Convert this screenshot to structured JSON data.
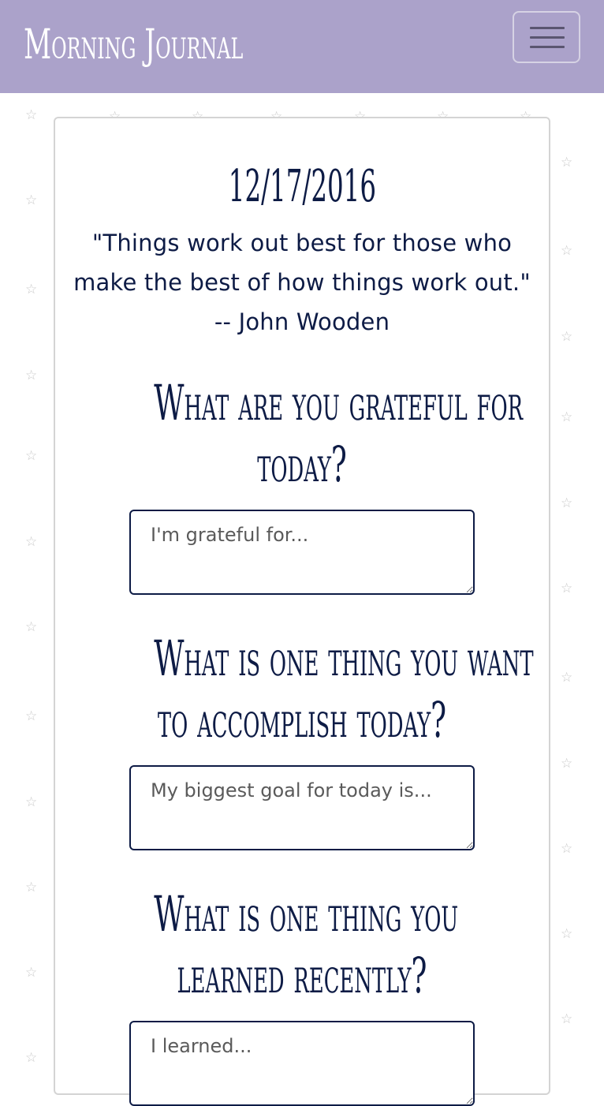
{
  "navbar": {
    "brand": "Morning Journal",
    "background_color": "#aba2ca",
    "menu_icon": "hamburger-icon"
  },
  "background": {
    "star_icon": "☆",
    "star_color": "#c9c9c9"
  },
  "journal": {
    "date": "12/17/2016",
    "quote": "\"Things work out best for those who make the best of how things work out.\" -- John Wooden",
    "text_color": "#0d1b45",
    "questions": [
      {
        "line1": "What are you grateful for",
        "line2": "today?",
        "placeholder": "I'm grateful for..."
      },
      {
        "line1": "What is one thing you want",
        "line2": "to accomplish today?",
        "placeholder": "My biggest goal for today is..."
      },
      {
        "line1": "What is one thing you",
        "line2": "learned recently?",
        "placeholder": "I learned..."
      }
    ]
  }
}
